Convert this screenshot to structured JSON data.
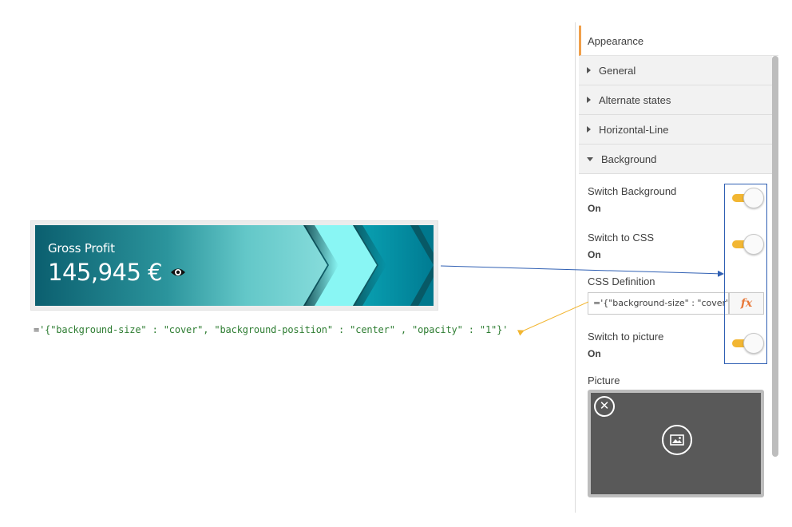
{
  "kpi": {
    "title": "Gross Profit",
    "value": "145,945 €",
    "icon": "eye-icon"
  },
  "expression": {
    "prefix": "=",
    "body": "'{\"background-size\" : \"cover\", \"background-position\" : \"center\" , \"opacity\" : \"1\"}'"
  },
  "panel": {
    "header": "Appearance",
    "sections": [
      {
        "label": "General",
        "expanded": false
      },
      {
        "label": "Alternate states",
        "expanded": false
      },
      {
        "label": "Horizontal-Line",
        "expanded": false
      },
      {
        "label": "Background",
        "expanded": true
      }
    ],
    "switch_background": {
      "label": "Switch Background",
      "value": "On"
    },
    "switch_css": {
      "label": "Switch to CSS",
      "value": "On"
    },
    "css_definition": {
      "label": "CSS Definition",
      "value": "='{\"background-size\" : \"cover\"",
      "fx_label": "fx"
    },
    "switch_picture": {
      "label": "Switch to picture",
      "value": "On"
    },
    "picture": {
      "label": "Picture",
      "remove_label": "✕"
    }
  },
  "colors": {
    "toggle_on": "#f2b632",
    "accent": "#f0a04b",
    "highlight": "#2f5fb3",
    "annotation_arrow_orange": "#f2b632",
    "annotation_arrow_blue": "#2f5fb3",
    "code_green": "#2e7d32"
  }
}
